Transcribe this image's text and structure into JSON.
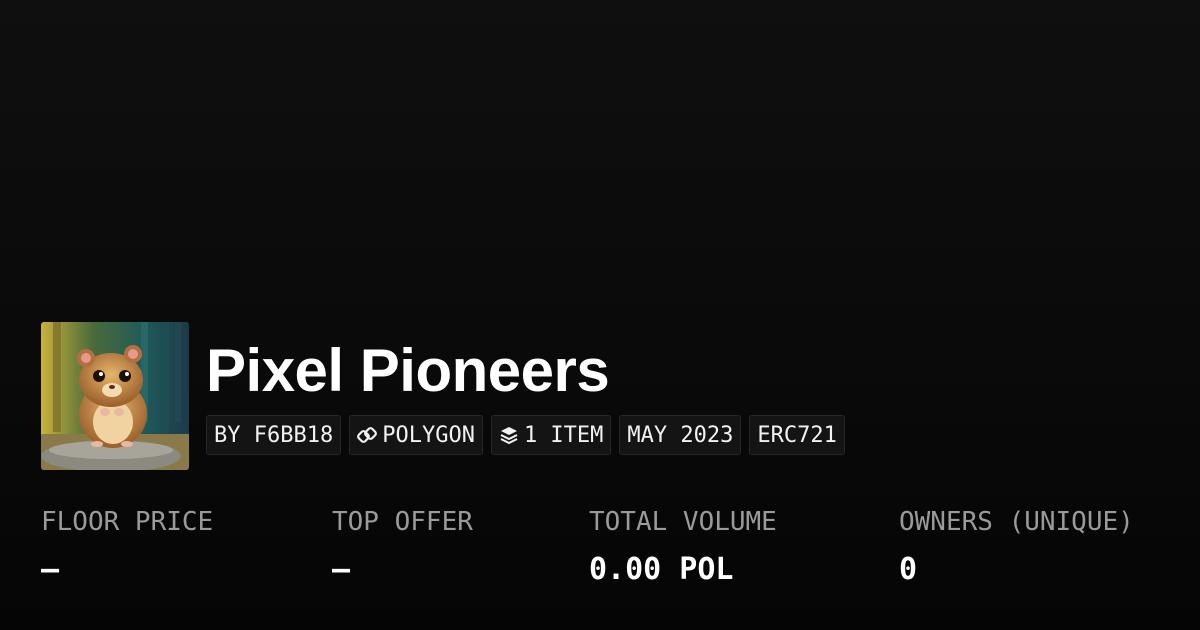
{
  "collection": {
    "title": "Pixel Pioneers",
    "avatar_alt": "hamster-in-forest"
  },
  "chips": {
    "creator": "BY F6BB18",
    "chain": "POLYGON",
    "chain_icon": "polygon-link-icon",
    "items": "1 ITEM",
    "items_icon": "layers-icon",
    "date": "MAY 2023",
    "standard": "ERC721"
  },
  "stats": {
    "floor_price": {
      "label": "FLOOR PRICE",
      "value": "–"
    },
    "top_offer": {
      "label": "TOP OFFER",
      "value": "–"
    },
    "total_volume": {
      "label": "TOTAL VOLUME",
      "value": "0.00 POL"
    },
    "owners": {
      "label": "OWNERS (UNIQUE)",
      "value": "0"
    }
  },
  "colors": {
    "background": "#0a0a0a",
    "chip_background": "#141414",
    "chip_border": "#262626",
    "label_gray": "#9a9a9a",
    "text_white": "#ffffff"
  }
}
